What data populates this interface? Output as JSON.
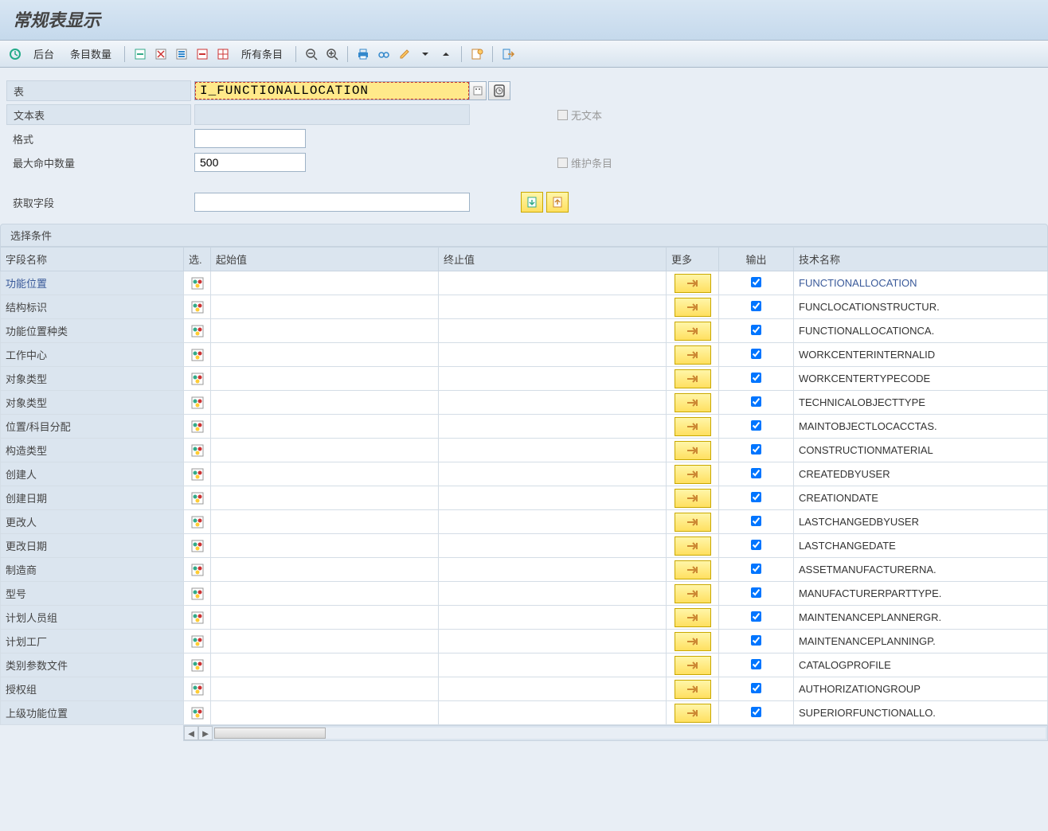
{
  "title": "常规表显示",
  "toolbar": {
    "background_label": "后台",
    "entries_label": "条目数量",
    "all_entries_label": "所有条目"
  },
  "form": {
    "table_label": "表",
    "table_value": "I_FUNCTIONALLOCATION",
    "text_table_label": "文本表",
    "no_text_label": "无文本",
    "format_label": "格式",
    "max_hits_label": "最大命中数量",
    "max_hits_value": "500",
    "maintain_label": "维护条目",
    "get_fields_label": "获取字段"
  },
  "section_label": "选择条件",
  "columns": {
    "field_name": "字段名称",
    "sel": "选.",
    "from_value": "起始值",
    "to_value": "终止值",
    "more": "更多",
    "output": "输出",
    "tech_name": "技术名称"
  },
  "rows": [
    {
      "label": "功能位置",
      "tech": "FUNCTIONALLOCATION",
      "highlight": true
    },
    {
      "label": "结构标识",
      "tech": "FUNCLOCATIONSTRUCTUR."
    },
    {
      "label": "功能位置种类",
      "tech": "FUNCTIONALLOCATIONCA."
    },
    {
      "label": "工作中心",
      "tech": "WORKCENTERINTERNALID"
    },
    {
      "label": "对象类型",
      "tech": "WORKCENTERTYPECODE"
    },
    {
      "label": "对象类型",
      "tech": "TECHNICALOBJECTTYPE"
    },
    {
      "label": "位置/科目分配",
      "tech": "MAINTOBJECTLOCACCTAS."
    },
    {
      "label": "构造类型",
      "tech": "CONSTRUCTIONMATERIAL"
    },
    {
      "label": "创建人",
      "tech": "CREATEDBYUSER"
    },
    {
      "label": "创建日期",
      "tech": "CREATIONDATE"
    },
    {
      "label": "更改人",
      "tech": "LASTCHANGEDBYUSER"
    },
    {
      "label": "更改日期",
      "tech": "LASTCHANGEDATE"
    },
    {
      "label": "制造商",
      "tech": "ASSETMANUFACTURERNA."
    },
    {
      "label": "型号",
      "tech": "MANUFACTURERPARTTYPE."
    },
    {
      "label": "计划人员组",
      "tech": "MAINTENANCEPLANNERGR."
    },
    {
      "label": "计划工厂",
      "tech": "MAINTENANCEPLANNINGP."
    },
    {
      "label": "类别参数文件",
      "tech": "CATALOGPROFILE"
    },
    {
      "label": "授权组",
      "tech": "AUTHORIZATIONGROUP"
    },
    {
      "label": "上级功能位置",
      "tech": "SUPERIORFUNCTIONALLO."
    }
  ]
}
